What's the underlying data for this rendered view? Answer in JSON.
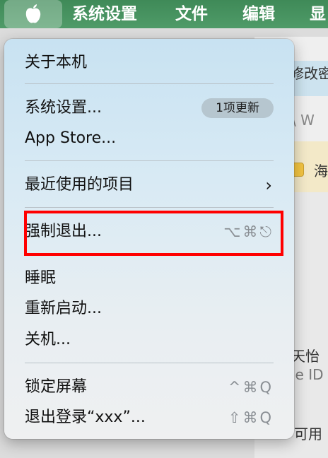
{
  "menubar": {
    "apple_logo": "",
    "items": [
      "系统设置",
      "文件",
      "编辑",
      "显"
    ]
  },
  "background": {
    "t1": "修改密",
    "t2": "\\ W",
    "t3": "海",
    "t4": "天怡",
    "t5": "le ID",
    "t6": "可用"
  },
  "menu": {
    "about": "关于本机",
    "system_settings": "系统设置...",
    "update_badge": "1项更新",
    "app_store": "App Store...",
    "recent_items": "最近使用的项目",
    "force_quit": "强制退出...",
    "force_quit_shortcut": "⌥⌘⎋",
    "sleep": "睡眠",
    "restart": "重新启动...",
    "shutdown": "关机...",
    "lock_screen": "锁定屏幕",
    "lock_screen_shortcut": "^⌘Q",
    "logout": "退出登录“xxx”...",
    "logout_shortcut": "⇧⌘Q"
  }
}
